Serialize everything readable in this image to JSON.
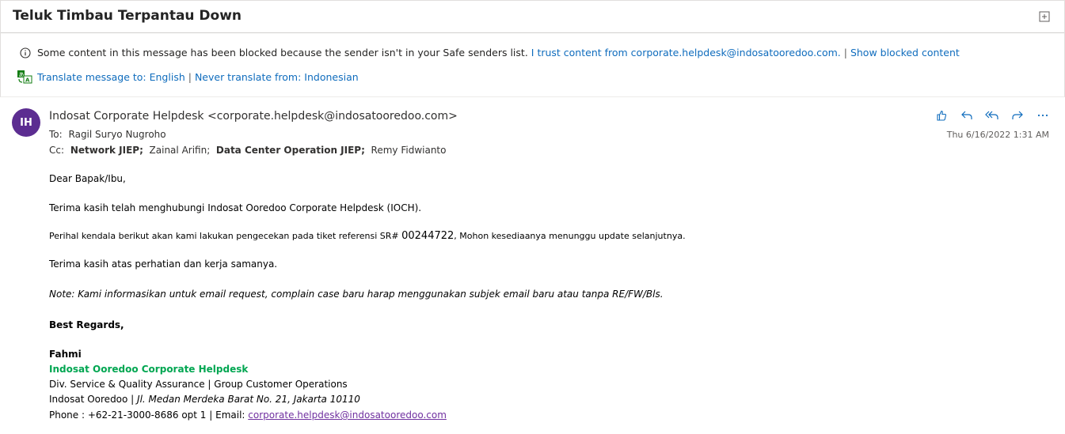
{
  "subject": "Teluk Timbau Terpantau Down",
  "notice": {
    "blocked_text": "Some content in this message has been blocked because the sender isn't in your Safe senders list.",
    "trust_link": "I trust content from corporate.helpdesk@indosatooredoo.com.",
    "separator": "|",
    "show_blocked_link": "Show blocked content",
    "translate_link": "Translate message to: English",
    "never_translate_link": "Never translate from: Indonesian"
  },
  "sender": {
    "initials": "IH",
    "from": "Indosat Corporate Helpdesk <corporate.helpdesk@indosatooredoo.com>",
    "to_label": "To:",
    "to": "Ragil Suryo Nugroho",
    "cc_label": "Cc:",
    "cc": [
      {
        "name": "Network JIEP;",
        "bold": true
      },
      {
        "name": "Zainal Arifin;",
        "bold": false
      },
      {
        "name": "Data Center Operation JIEP;",
        "bold": true
      },
      {
        "name": "Remy Fidwianto",
        "bold": false
      }
    ],
    "date": "Thu 6/16/2022 1:31 AM",
    "avatar_color": "#5c2d91"
  },
  "actions": [
    "like-icon",
    "reply-icon",
    "reply-all-icon",
    "forward-icon",
    "more-icon"
  ],
  "body": {
    "greeting": "Dear Bapak/Ibu,",
    "thanks": "Terima kasih telah menghubungi Indosat Ooredoo Corporate Helpdesk (IOCH).",
    "perihal_pre": "Perihal kendala berikut akan kami lakukan pengecekan pada tiket referensi SR#",
    "sr_number": "00244722",
    "perihal_post": ", Mohon kesediaanya menunggu update selanjutnya.",
    "closing": "Terima kasih atas perhatian dan kerja samanya.",
    "note": "Note: Kami informasikan untuk email request, complain  case baru harap menggunakan subjek email baru atau tanpa RE/FW/Bls.",
    "regards": "Best Regards,",
    "sig_name": "Fahmi",
    "sig_org": "Indosat Ooredoo Corporate Helpdesk",
    "sig_div": "Div. Service & Quality Assurance | Group Customer Operations",
    "sig_addr_pre": "Indosat Ooredoo | ",
    "sig_addr_italic": "Jl. Medan Merdeka Barat No. 21, Jakarta 10110",
    "sig_phone_pre": "Phone : +62-21-3000-8686 opt 1  | Email: ",
    "sig_email": "corporate.helpdesk@indosatooredoo.com"
  },
  "colors": {
    "link": "#0f6cbd",
    "signature_green": "#00a651",
    "email_purple": "#7030a0"
  }
}
